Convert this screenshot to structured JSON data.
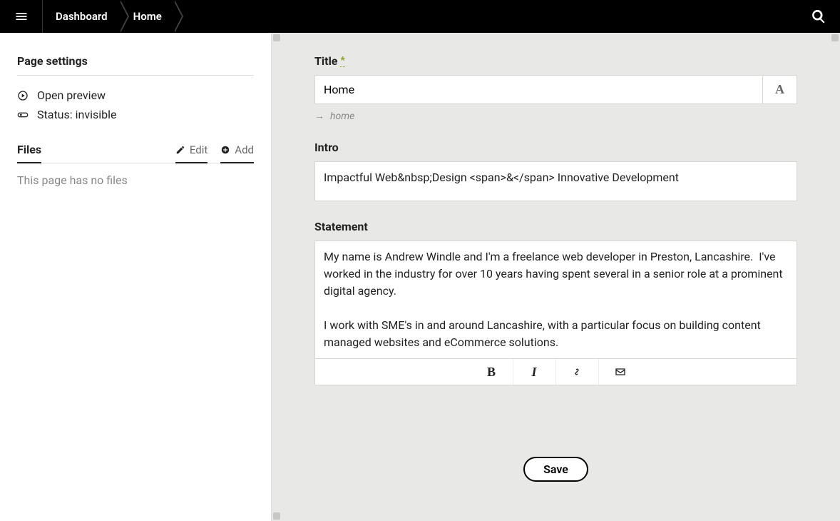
{
  "topbar": {
    "crumbs": [
      "Dashboard",
      "Home"
    ]
  },
  "sidebar": {
    "settings_title": "Page settings",
    "open_preview": "Open preview",
    "status_label": "Status: invisible",
    "files_title": "Files",
    "edit_label": "Edit",
    "add_label": "Add",
    "files_empty": "This page has no files"
  },
  "form": {
    "title_label": "Title",
    "required_mark": "*",
    "title_value": "Home",
    "slug": "home",
    "intro_label": "Intro",
    "intro_value": "Impactful Web&nbsp;Design <span>&</span> Innovative Development",
    "statement_label": "Statement",
    "statement_value": "My name is Andrew Windle and I'm a freelance web developer in Preston, Lancashire.  I've worked in the industry for over 10 years having spent several in a senior role at a prominent digital agency.\n\nI work with SME's in and around Lancashire, with a particular focus on building content managed websites and eCommerce solutions.",
    "save_label": "Save"
  }
}
